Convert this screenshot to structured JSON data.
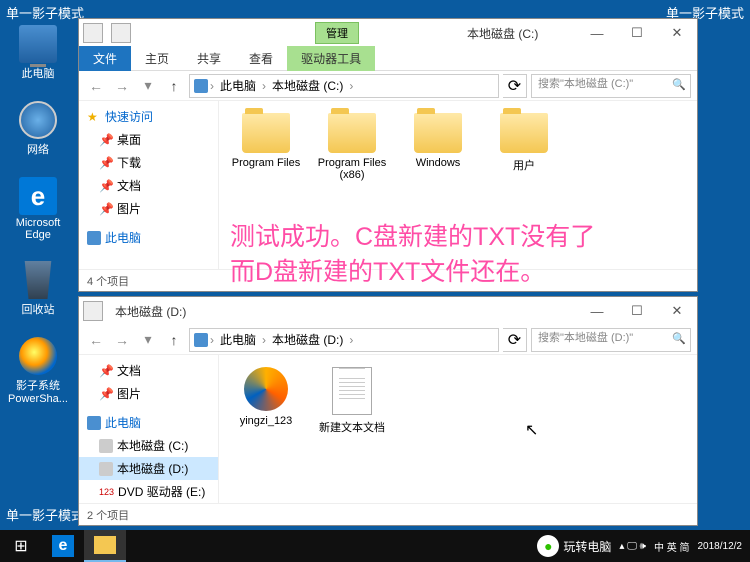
{
  "corners": {
    "tl": "单一影子模式",
    "tr": "单一影子模式",
    "bl": "单一影子模式"
  },
  "desktop": [
    {
      "label": "此电脑",
      "cls": "pc-ic"
    },
    {
      "label": "网络",
      "cls": "net-ic"
    },
    {
      "label": "Microsoft Edge",
      "cls": "edge-ic",
      "glyph": "e"
    },
    {
      "label": "回收站",
      "cls": "bin-ic"
    },
    {
      "label": "影子系统 PowerSha...",
      "cls": "shadow-ic"
    }
  ],
  "overlay": {
    "line1": "测试成功。C盘新建的TXT没有了",
    "line2": "而D盘新建的TXT文件还在。"
  },
  "win1": {
    "title": "本地磁盘 (C:)",
    "mgmt_tab": "管理",
    "ribbon_file": "文件",
    "ribbon_tabs": [
      "主页",
      "共享",
      "查看"
    ],
    "ribbon_tool": "驱动器工具",
    "crumbs": [
      "此电脑",
      "本地磁盘 (C:)"
    ],
    "search_ph": "搜索\"本地磁盘 (C:)\"",
    "sidebar": {
      "quick": "快速访问",
      "items": [
        "桌面",
        "下载",
        "文档",
        "图片"
      ],
      "pc": "此电脑"
    },
    "files": [
      {
        "name": "Program Files",
        "type": "folder"
      },
      {
        "name": "Program Files (x86)",
        "type": "folder"
      },
      {
        "name": "Windows",
        "type": "folder"
      },
      {
        "name": "用户",
        "type": "folder"
      }
    ],
    "status": "4 个项目"
  },
  "win2": {
    "title": "本地磁盘 (D:)",
    "crumbs": [
      "此电脑",
      "本地磁盘 (D:)"
    ],
    "search_ph": "搜索\"本地磁盘 (D:)\"",
    "sidebar": {
      "items": [
        "文档",
        "图片"
      ],
      "pc": "此电脑",
      "drives": [
        "本地磁盘 (C:)",
        "本地磁盘 (D:)"
      ],
      "dvd": "DVD 驱动器 (E:)"
    },
    "files": [
      {
        "name": "yingzi_123",
        "type": "swirl"
      },
      {
        "name": "新建文本文档",
        "type": "file"
      }
    ],
    "status": "2 个项目"
  },
  "taskbar": {
    "wechat": "玩转电脑",
    "ime": "中 英 简",
    "time": "2018/12/2"
  }
}
